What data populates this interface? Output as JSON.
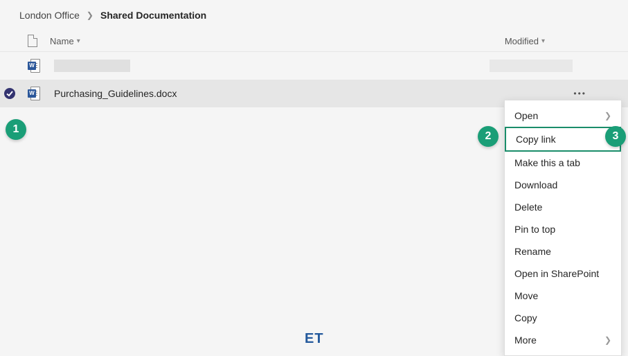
{
  "breadcrumb": {
    "parent": "London Office",
    "current": "Shared Documentation"
  },
  "columns": {
    "name": "Name",
    "modified": "Modified"
  },
  "rows": [
    {
      "name": "",
      "redacted": true
    },
    {
      "name": "Purchasing_Guidelines.docx",
      "selected": true
    }
  ],
  "menu": {
    "items": [
      {
        "label": "Open",
        "has_submenu": true
      },
      {
        "label": "Copy link",
        "highlighted": true
      },
      {
        "label": "Make this a tab"
      },
      {
        "label": "Download"
      },
      {
        "label": "Delete"
      },
      {
        "label": "Pin to top"
      },
      {
        "label": "Rename"
      },
      {
        "label": "Open in SharePoint"
      },
      {
        "label": "Move"
      },
      {
        "label": "Copy"
      },
      {
        "label": "More",
        "has_submenu": true
      }
    ]
  },
  "badges": {
    "b1": "1",
    "b2": "2",
    "b3": "3"
  },
  "watermark": "ET"
}
